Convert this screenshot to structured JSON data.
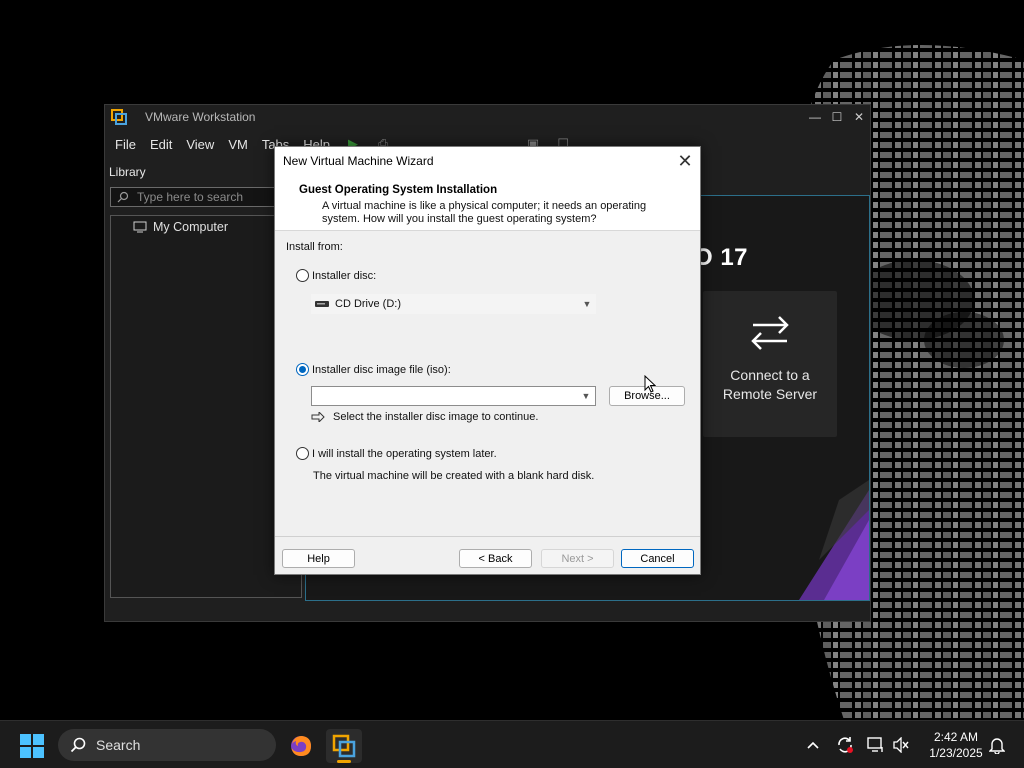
{
  "vmware_window": {
    "title": "VMware Workstation",
    "menu": [
      "File",
      "Edit",
      "View",
      "VM",
      "Tabs",
      "Help"
    ],
    "library": {
      "header": "Library",
      "search_placeholder": "Type here to search",
      "tree": [
        {
          "label": "My Computer"
        }
      ]
    },
    "home": {
      "brand_text": "O 17",
      "remote_card_line1": "Connect to a",
      "remote_card_line2": "Remote Server"
    },
    "window_controls": {
      "minimize": "—",
      "maximize": "☐",
      "close": "✕"
    }
  },
  "wizard": {
    "title": "New Virtual Machine Wizard",
    "close_glyph": "✕",
    "header_title": "Guest Operating System Installation",
    "header_desc": "A virtual machine is like a physical computer; it needs an operating system. How will you install the guest operating system?",
    "install_from_label": "Install from:",
    "option_disc": {
      "label": "Installer disc:",
      "selected": false
    },
    "disc_drive_value": "CD Drive (D:)",
    "option_iso": {
      "label": "Installer disc image file (iso):",
      "selected": true
    },
    "iso_path_value": "",
    "browse_label": "Browse...",
    "hint_text": "Select the installer disc image to continue.",
    "option_later": {
      "label": "I will install the operating system later.",
      "selected": false
    },
    "later_desc": "The virtual machine will be created with a blank hard disk.",
    "buttons": {
      "help": "Help",
      "back": "< Back",
      "next": "Next >",
      "cancel": "Cancel"
    }
  },
  "taskbar": {
    "search_label": "Search",
    "clock_time": "2:42 AM",
    "clock_date": "1/23/2025"
  },
  "colors": {
    "accent": "#0067c0",
    "taskbar_bg": "#1c1c1c",
    "vmware_orange": "#f0a400"
  }
}
